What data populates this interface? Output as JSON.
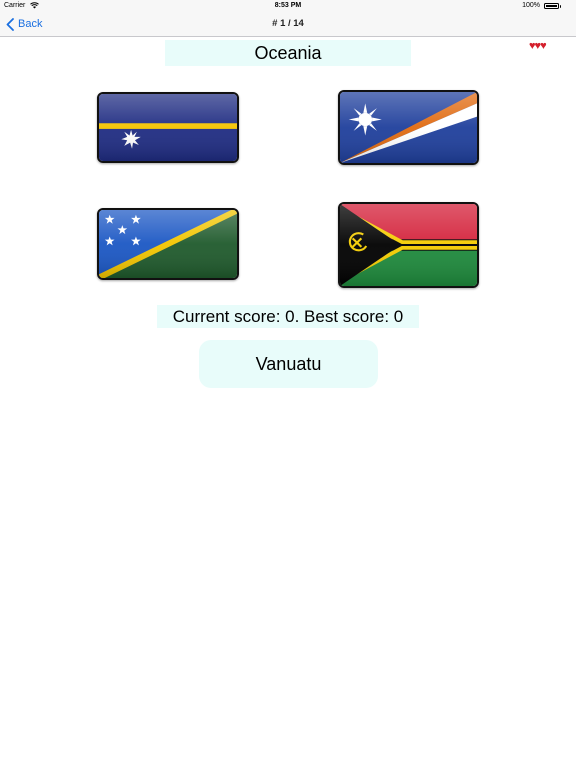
{
  "status_bar": {
    "carrier": "Carrier",
    "time": "8:53 PM",
    "battery": "100%",
    "wifi_icon": "wifi-icon",
    "battery_icon": "battery-icon"
  },
  "nav": {
    "back_label": "Back",
    "back_icon": "chevron-left-icon",
    "title": "# 1 / 14",
    "accent_color": "#1a6fe0"
  },
  "quiz": {
    "region": "Oceania",
    "lives": "♥♥♥",
    "lives_count": 3,
    "lives_color": "#d4202c",
    "options": [
      {
        "flag": "Nauru",
        "icon": "nauru-flag-icon"
      },
      {
        "flag": "Marshall Islands",
        "icon": "marshall-islands-flag-icon"
      },
      {
        "flag": "Solomon Islands",
        "icon": "solomon-islands-flag-icon"
      },
      {
        "flag": "Vanuatu",
        "icon": "vanuatu-flag-icon"
      }
    ],
    "score_text": "Current score: 0. Best score: 0",
    "answer": "Vanuatu",
    "panel_color": "#e8fcfa"
  }
}
